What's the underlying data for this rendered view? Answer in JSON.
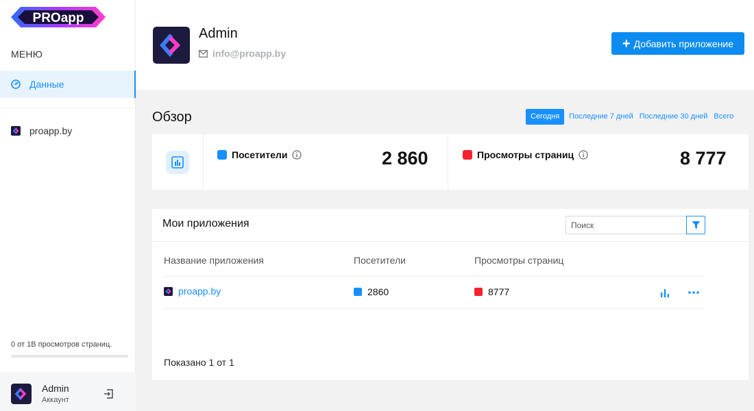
{
  "brand": {
    "logo_text": "PROapp",
    "accent": "#1890ff",
    "button_color": "#0c8cf0",
    "visitors_color": "#1890ff",
    "pageviews_color": "#f5222d"
  },
  "sidebar": {
    "menu_title": "МЕНЮ",
    "items": [
      {
        "label": "Данные",
        "icon": "dashboard-icon",
        "active": true
      }
    ],
    "apps": [
      {
        "label": "proapp.by",
        "icon": "app-logo-icon"
      }
    ],
    "quota": {
      "text": "0 от 1В просмотров страниц.",
      "used_fraction": 0
    },
    "account": {
      "name": "Admin",
      "subtitle": "Аккаунт",
      "logout_icon": "logout-icon"
    }
  },
  "header": {
    "user_name": "Admin",
    "email": "info@proapp.by",
    "add_button": "Добавить приложение"
  },
  "overview": {
    "title": "Обзор",
    "periods": [
      "Сегодня",
      "Последние 7 дней",
      "Последние 30 дней",
      "Всего"
    ],
    "active_period": "Сегодня",
    "stats": [
      {
        "label": "Посетители",
        "value": "2 860"
      },
      {
        "label": "Просмотры страниц",
        "value": "8 777"
      }
    ]
  },
  "apps_table": {
    "title": "Мои приложения",
    "search_placeholder": "Поиск",
    "columns": [
      "Название приложения",
      "Посетители",
      "Просмотры страниц"
    ],
    "rows": [
      {
        "name": "proapp.by",
        "visitors": "2860",
        "pageviews": "8777"
      }
    ],
    "footer": "Показано 1 от 1"
  }
}
